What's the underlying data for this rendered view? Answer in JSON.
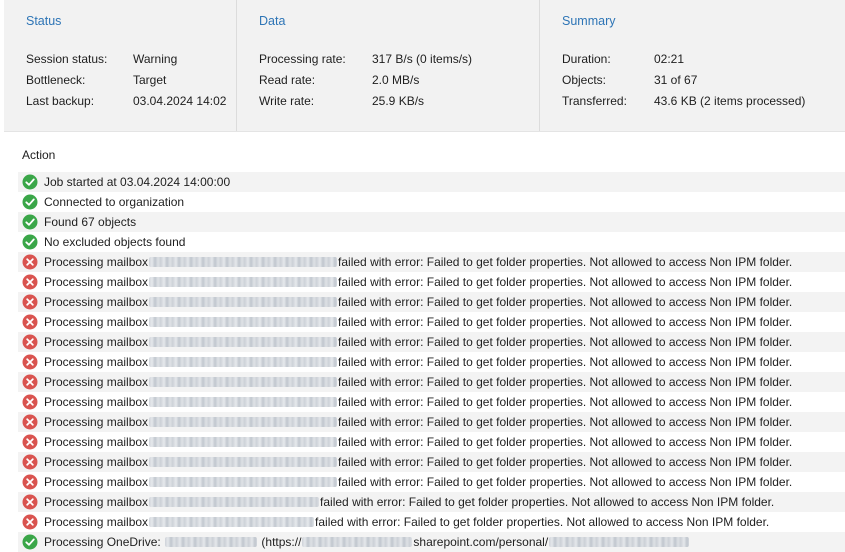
{
  "summary_panel": {
    "status": {
      "title": "Status",
      "session_status_label": "Session status:",
      "session_status_value": "Warning",
      "bottleneck_label": "Bottleneck:",
      "bottleneck_value": "Target",
      "last_backup_label": "Last backup:",
      "last_backup_value": "03.04.2024 14:02"
    },
    "data": {
      "title": "Data",
      "processing_rate_label": "Processing rate:",
      "processing_rate_value": "317 B/s (0 items/s)",
      "read_rate_label": "Read rate:",
      "read_rate_value": "2.0 MB/s",
      "write_rate_label": "Write rate:",
      "write_rate_value": "25.9 KB/s"
    },
    "summary": {
      "title": "Summary",
      "duration_label": "Duration:",
      "duration_value": "02:21",
      "objects_label": "Objects:",
      "objects_value": "31 of 67",
      "transferred_label": "Transferred:",
      "transferred_value": "43.6 KB (2 items processed)"
    }
  },
  "action_log": {
    "header": "Action",
    "rows": [
      {
        "status": "success",
        "prefix": "Job started at 03.04.2024 14:00:00"
      },
      {
        "status": "success",
        "prefix": "Connected to organization"
      },
      {
        "status": "success",
        "prefix": "Found 67 objects"
      },
      {
        "status": "success",
        "prefix": "No excluded objects found"
      },
      {
        "status": "error",
        "prefix": "Processing mailbox",
        "suffix": "failed with error: Failed to get folder properties. Not allowed to access Non IPM folder."
      },
      {
        "status": "error",
        "prefix": "Processing mailbox",
        "suffix": "failed with error: Failed to get folder properties. Not allowed to access Non IPM folder."
      },
      {
        "status": "error",
        "prefix": "Processing mailbox",
        "suffix": "failed with error: Failed to get folder properties. Not allowed to access Non IPM folder."
      },
      {
        "status": "error",
        "prefix": "Processing mailbox",
        "suffix": "failed with error: Failed to get folder properties. Not allowed to access Non IPM folder."
      },
      {
        "status": "error",
        "prefix": "Processing mailbox",
        "suffix": "failed with error: Failed to get folder properties. Not allowed to access Non IPM folder."
      },
      {
        "status": "error",
        "prefix": "Processing mailbox",
        "suffix": "failed with error: Failed to get folder properties. Not allowed to access Non IPM folder."
      },
      {
        "status": "error",
        "prefix": "Processing mailbox",
        "suffix": "failed with error: Failed to get folder properties. Not allowed to access Non IPM folder."
      },
      {
        "status": "error",
        "prefix": "Processing mailbox",
        "suffix": "failed with error: Failed to get folder properties. Not allowed to access Non IPM folder."
      },
      {
        "status": "error",
        "prefix": "Processing mailbox",
        "suffix": "failed with error: Failed to get folder properties. Not allowed to access Non IPM folder."
      },
      {
        "status": "error",
        "prefix": "Processing mailbox",
        "suffix": "failed with error: Failed to get folder properties. Not allowed to access Non IPM folder."
      },
      {
        "status": "error",
        "prefix": "Processing mailbox",
        "suffix": "failed with error: Failed to get folder properties. Not allowed to access Non IPM folder."
      },
      {
        "status": "error",
        "prefix": "Processing mailbox",
        "suffix": "failed with error: Failed to get folder properties. Not allowed to access Non IPM folder."
      },
      {
        "status": "error",
        "prefix": "Processing mailbox",
        "suffix": "failed with error: Failed to get folder properties. Not allowed to access Non IPM folder."
      },
      {
        "status": "error",
        "prefix": "Processing mailbox",
        "suffix": "failed with error: Failed to get folder properties. Not allowed to access Non IPM folder."
      },
      {
        "status": "success",
        "prefix": "Processing OneDrive:",
        "middle": "(https://",
        "suffix": "sharepoint.com/personal/"
      }
    ]
  },
  "icons": {
    "success": "check-circle-icon",
    "error": "error-x-circle-icon"
  },
  "colors": {
    "accent": "#2e75b6",
    "success": "#3aa648",
    "error": "#d9534f"
  }
}
